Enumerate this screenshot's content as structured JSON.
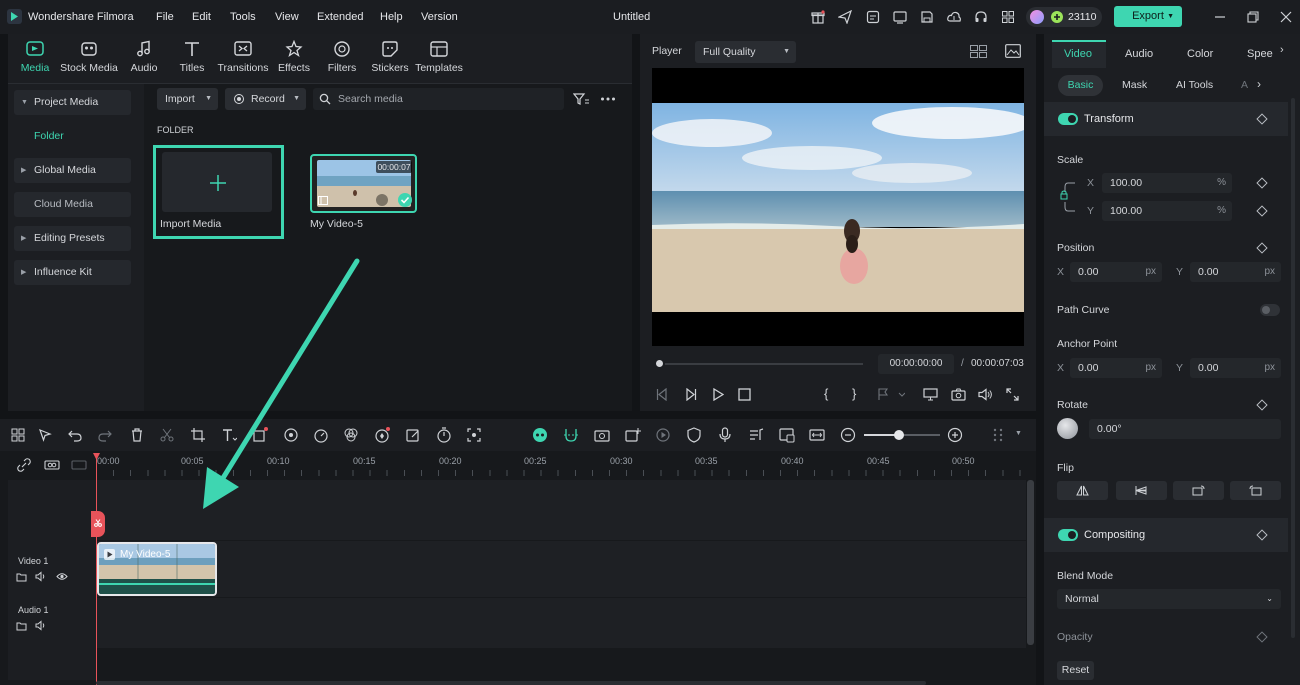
{
  "app": {
    "name": "Wondershare Filmora",
    "title": "Untitled",
    "credits": "23110",
    "export_label": "Export"
  },
  "menu": [
    "File",
    "Edit",
    "Tools",
    "View",
    "Extended",
    "Help",
    "Version"
  ],
  "media_tabs": [
    {
      "label": "Media",
      "icon": "media-icon",
      "active": true
    },
    {
      "label": "Stock Media",
      "icon": "stock-media-icon"
    },
    {
      "label": "Audio",
      "icon": "audio-icon"
    },
    {
      "label": "Titles",
      "icon": "titles-icon"
    },
    {
      "label": "Transitions",
      "icon": "transitions-icon"
    },
    {
      "label": "Effects",
      "icon": "effects-icon"
    },
    {
      "label": "Filters",
      "icon": "filters-icon"
    },
    {
      "label": "Stickers",
      "icon": "stickers-icon"
    },
    {
      "label": "Templates",
      "icon": "templates-icon"
    }
  ],
  "sidebar": {
    "project_media": "Project Media",
    "folder": "Folder",
    "global_media": "Global Media",
    "cloud_media": "Cloud Media",
    "editing_presets": "Editing Presets",
    "influence_kit": "Influence Kit"
  },
  "media_toolbar": {
    "import": "Import",
    "record": "Record",
    "search_placeholder": "Search media"
  },
  "media_area": {
    "folder_heading": "FOLDER",
    "import_label": "Import Media",
    "clip_name": "My Video-5",
    "clip_duration": "00:00:07"
  },
  "player": {
    "label": "Player",
    "quality": "Full Quality",
    "current_time": "00:00:00:00",
    "separator": "/",
    "total_time": "00:00:07:03"
  },
  "properties": {
    "tabs": [
      "Video",
      "Audio",
      "Color",
      "Speed"
    ],
    "subtabs": [
      "Basic",
      "Mask",
      "AI Tools",
      "A"
    ],
    "transform": "Transform",
    "scale": "Scale",
    "scale_x_label": "X",
    "scale_y_label": "Y",
    "scale_x": "100.00",
    "scale_y": "100.00",
    "percent": "%",
    "position": "Position",
    "pos_x_label": "X",
    "pos_y_label": "Y",
    "pos_x": "0.00",
    "pos_y": "0.00",
    "px": "px",
    "path_curve": "Path Curve",
    "anchor_point": "Anchor Point",
    "anchor_x_label": "X",
    "anchor_y_label": "Y",
    "anchor_x": "0.00",
    "anchor_y": "0.00",
    "rotate": "Rotate",
    "rotate_value": "0.00°",
    "flip": "Flip",
    "compositing": "Compositing",
    "blend_mode": "Blend Mode",
    "blend_value": "Normal",
    "opacity": "Opacity",
    "reset": "Reset"
  },
  "timeline": {
    "ticks": [
      "00:00",
      "00:05",
      "00:10",
      "00:15",
      "00:20",
      "00:25",
      "00:30",
      "00:35",
      "00:40",
      "00:45",
      "00:50"
    ],
    "video_track": "Video 1",
    "audio_track": "Audio 1",
    "clip_label": "My Video-5"
  },
  "colors": {
    "accent": "#3ed6b1",
    "playhead": "#e8535a",
    "background": "#121417"
  }
}
